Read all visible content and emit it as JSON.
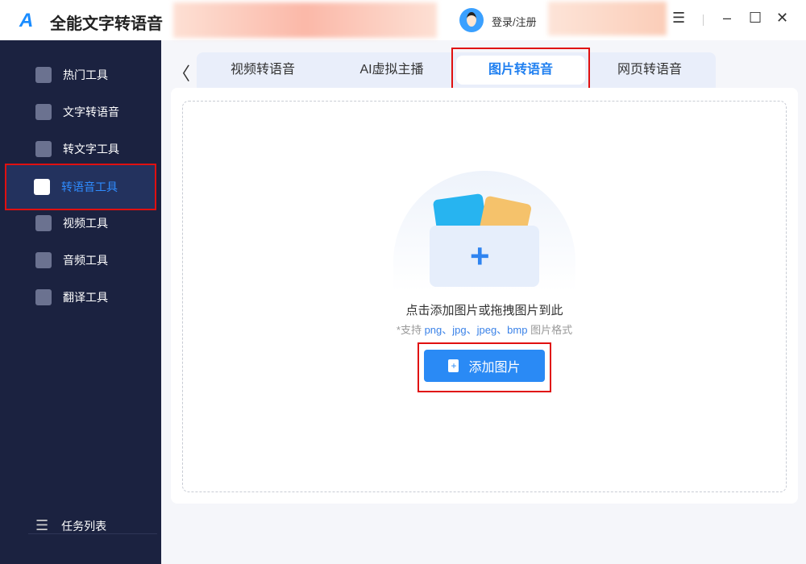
{
  "app": {
    "logo": "A",
    "title": "全能文字转语音",
    "login": "登录/注册"
  },
  "window": {
    "menu": "☰",
    "minimize": "–",
    "maximize": "☐",
    "close": "✕"
  },
  "sidebar": {
    "items": [
      {
        "label": "热门工具"
      },
      {
        "label": "文字转语音"
      },
      {
        "label": "转文字工具"
      },
      {
        "label": "转语音工具",
        "active": true
      },
      {
        "label": "视频工具"
      },
      {
        "label": "音频工具"
      },
      {
        "label": "翻译工具"
      }
    ],
    "task_list": "任务列表"
  },
  "tabs": {
    "back": "〈",
    "items": [
      {
        "label": "视频转语音"
      },
      {
        "label": "AI虚拟主播"
      },
      {
        "label": "图片转语音",
        "active": true
      },
      {
        "label": "网页转语音"
      }
    ]
  },
  "drop": {
    "hint": "点击添加图片或拖拽图片到此",
    "support_prefix": "*支持 ",
    "formats": "png、jpg、jpeg、bmp",
    "support_suffix": " 图片格式",
    "button": "添加图片"
  },
  "colors": {
    "accent": "#2a8af5",
    "sidebar": "#1b2240",
    "highlight": "#e01010"
  }
}
